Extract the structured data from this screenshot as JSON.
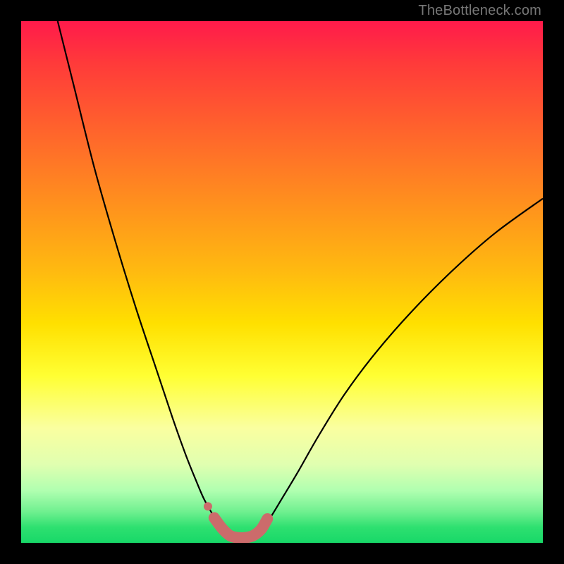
{
  "watermark": "TheBottleneck.com",
  "colors": {
    "frame": "#000000",
    "curve": "#000000",
    "band": "#cc6b6b",
    "gradient_top": "#ff1a4b",
    "gradient_bottom": "#18d868"
  },
  "chart_data": {
    "type": "line",
    "title": "",
    "xlabel": "",
    "ylabel": "",
    "xlim": [
      0,
      100
    ],
    "ylim": [
      0,
      100
    ],
    "grid": false,
    "legend": false,
    "series": [
      {
        "name": "left-branch",
        "x": [
          7,
          10,
          14,
          18,
          22,
          26,
          29,
          31.5,
          33.5,
          35,
          36.5,
          38,
          39,
          40
        ],
        "y": [
          100,
          88,
          72,
          58,
          45,
          33,
          24,
          17,
          12,
          8.5,
          5.8,
          3.8,
          2.4,
          1.2
        ]
      },
      {
        "name": "right-branch",
        "x": [
          45,
          46.5,
          48,
          50,
          53,
          57,
          62,
          68,
          75,
          83,
          91,
          100
        ],
        "y": [
          1.2,
          3.0,
          5.2,
          8.5,
          13.5,
          20.5,
          28.5,
          36.5,
          44.5,
          52.5,
          59.5,
          66.0
        ]
      },
      {
        "name": "highlight-band",
        "x": [
          37,
          38.5,
          40,
          41.5,
          43,
          44.5,
          46,
          47.2
        ],
        "y": [
          4.8,
          2.8,
          1.4,
          1.0,
          1.0,
          1.4,
          2.6,
          4.6
        ]
      },
      {
        "name": "highlight-dot",
        "x": [
          35.8
        ],
        "y": [
          7.0
        ]
      }
    ],
    "notes": "V-shaped bottleneck curve over vertical rainbow gradient (red=high bottleneck at top, green=low at bottom). Highlight band marks the valley floor. Axes unlabeled; values estimated as percentage of plot extent."
  }
}
